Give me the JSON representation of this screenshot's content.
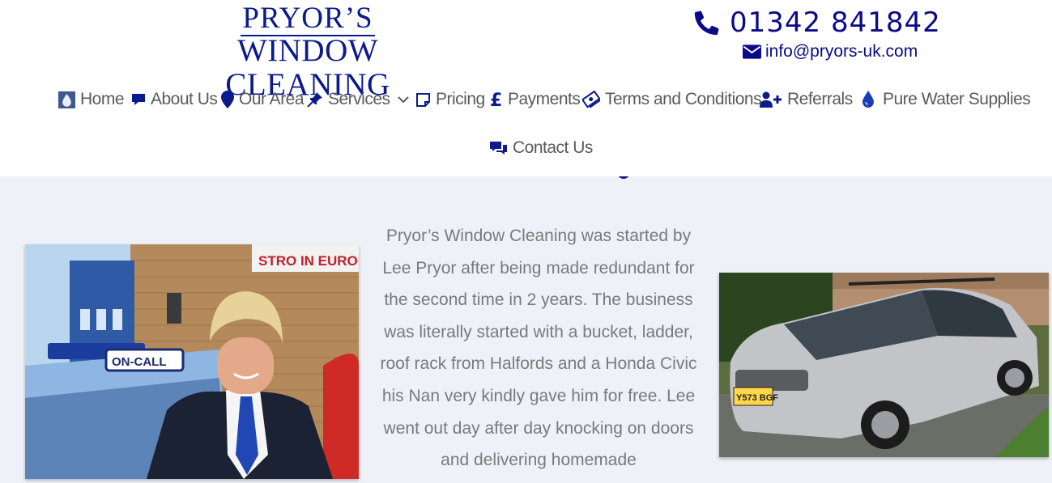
{
  "logo": {
    "line1": "PRYOR’S",
    "line2": "WINDOW CLEANING"
  },
  "contact": {
    "phone": "01342 841842",
    "email": "info@pryors-uk.com"
  },
  "nav": {
    "items": [
      {
        "label": "Home",
        "icon": "water-drop-logo-icon"
      },
      {
        "label": "About Us",
        "icon": "comment-icon"
      },
      {
        "label": "Our Area",
        "icon": "map-pin-icon"
      },
      {
        "label": "Services",
        "icon": "thumbtack-icon"
      },
      {
        "label": "Pricing",
        "icon": "sticky-note-icon"
      },
      {
        "label": "Payments",
        "icon": "pound-icon"
      },
      {
        "label": "Terms and Conditions",
        "icon": "money-bills-icon"
      },
      {
        "label": "Referrals",
        "icon": "user-plus-icon"
      },
      {
        "label": "Pure Water Supplies",
        "icon": "water-drop-icon"
      },
      {
        "label": "Contact Us",
        "icon": "comments-icon"
      }
    ]
  },
  "story": {
    "text": "Pryor’s Window Cleaning was started by Lee Pryor after being made redundant for the second time in 2 years. The business was literally started with a bucket, ladder, roof rack from Halfords and a Honda Civic his Nan very kindly gave him for free. Lee went out day after day knocking on doors and delivering homemade"
  },
  "photos": {
    "left_sign": "ON-CALL",
    "left_banner": "STRO IN EUROPE",
    "right_plate": "Y573 BGF"
  },
  "colors": {
    "brand": "#0b1a8c",
    "nav_text": "#5a5a5a",
    "body_text": "#7a7a7a",
    "band": "#eff1f8"
  }
}
